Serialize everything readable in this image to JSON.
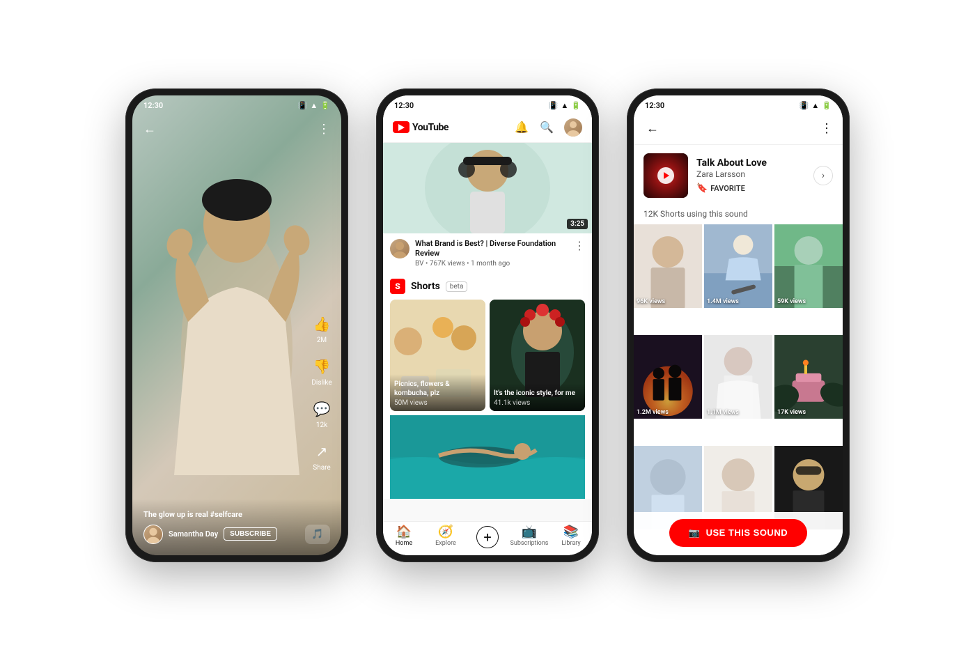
{
  "phones": {
    "phone1": {
      "status_time": "12:30",
      "caption": "The glow up is real #selfcare",
      "hashtag": "#selfcare",
      "author": "Samantha Day",
      "subscribe": "SUBSCRIBE",
      "likes": "2M",
      "dislike_label": "Dislike",
      "comments": "12k",
      "share_label": "Share",
      "back_icon": "←",
      "more_icon": "⋮"
    },
    "phone2": {
      "status_time": "12:30",
      "logo_text": "YouTube",
      "video": {
        "title": "What Brand is Best? | Diverse Foundation Review",
        "channel": "BV",
        "meta": "767K views • 1 month ago",
        "duration": "3:25"
      },
      "shorts": {
        "label": "Shorts",
        "beta": "beta",
        "card1": {
          "caption": "Picnics, flowers & kombucha, plz",
          "views": "50M views"
        },
        "card2": {
          "caption": "It's the iconic style, for me",
          "views": "41.1k views"
        }
      },
      "nav": {
        "home": "Home",
        "explore": "Explore",
        "add": "+",
        "subscriptions": "Subscriptions",
        "library": "Library"
      }
    },
    "phone3": {
      "status_time": "12:30",
      "back_icon": "←",
      "more_icon": "⋮",
      "song": {
        "title": "Talk About Love",
        "artist": "Zara Larsson",
        "favorite": "FAVORITE"
      },
      "shorts_count": "12K Shorts using this sound",
      "videos": [
        {
          "views": "96K views"
        },
        {
          "views": "1.4M views"
        },
        {
          "views": "59K views"
        },
        {
          "views": "1.2M views"
        },
        {
          "views": "1.1M views"
        },
        {
          "views": "17K views"
        },
        {
          "views": ""
        },
        {
          "views": ""
        },
        {
          "views": ""
        }
      ],
      "use_sound_btn": "USE THIS SOUND"
    }
  }
}
